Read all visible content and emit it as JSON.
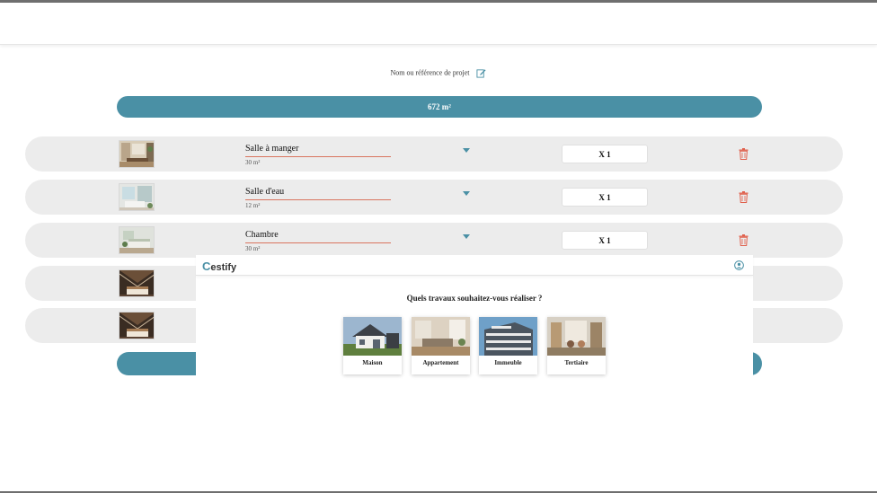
{
  "project": {
    "name_placeholder": "Nom ou référence de projet",
    "edit_icon": "pencil-square-icon"
  },
  "surface": {
    "total": "672 m²"
  },
  "colors": {
    "accent": "#4a90a5",
    "underline": "#d9745f",
    "delete": "#e0604c",
    "row_bg": "#ececec"
  },
  "rooms": [
    {
      "name": "Salle à manger",
      "area": "30 m²",
      "quantity": "X 1",
      "thumb": "dining-room-thumbnail"
    },
    {
      "name": "Salle d'eau",
      "area": "12 m²",
      "quantity": "X 1",
      "thumb": "bathroom-thumbnail"
    },
    {
      "name": "Chambre",
      "area": "30 m²",
      "quantity": "X 1",
      "thumb": "bedroom-thumbnail"
    },
    {
      "thumb": "attic-room-thumbnail"
    },
    {
      "thumb": "attic-room-thumbnail"
    }
  ],
  "modal": {
    "logo_text": "estify",
    "question": "Quels travaux souhaitez-vous réaliser ?",
    "types": [
      {
        "label": "Maison"
      },
      {
        "label": "Appartement"
      },
      {
        "label": "Immeuble"
      },
      {
        "label": "Tertiaire"
      }
    ]
  }
}
